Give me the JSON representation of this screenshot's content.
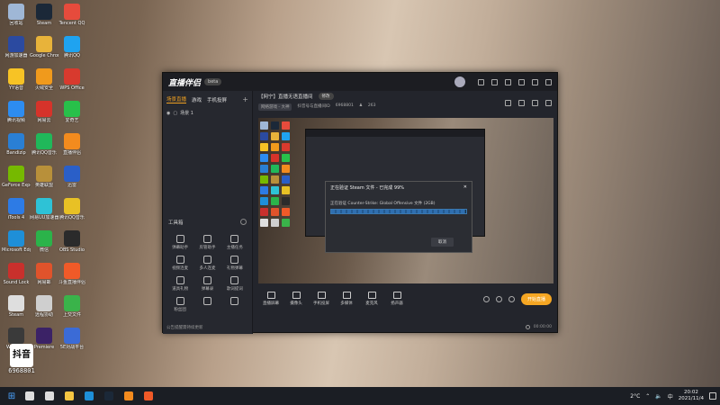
{
  "desktop": {
    "icons": [
      {
        "label": "回收站",
        "color": "#9fb7d6"
      },
      {
        "label": "Steam",
        "color": "#1b2838"
      },
      {
        "label": "Tencent QQ",
        "color": "#e64b3c"
      },
      {
        "label": "网游加速器",
        "color": "#2b4aa0"
      },
      {
        "label": "Google Chrome",
        "color": "#e8b33a"
      },
      {
        "label": "腾讯QQ",
        "color": "#1fa3f0"
      },
      {
        "label": "YY语音",
        "color": "#f7c325"
      },
      {
        "label": "火绒安全",
        "color": "#f09a1c"
      },
      {
        "label": "WPS Office",
        "color": "#d83a2e"
      },
      {
        "label": "腾讯视频",
        "color": "#2d8cf0"
      },
      {
        "label": "网易云",
        "color": "#d6332a"
      },
      {
        "label": "爱奇艺",
        "color": "#28c04a"
      },
      {
        "label": "Bandizip",
        "color": "#2a7fd4"
      },
      {
        "label": "腾讯QQ音乐",
        "color": "#20b85a"
      },
      {
        "label": "直播伴侣",
        "color": "#f38b1e"
      },
      {
        "label": "GeForce Experience",
        "color": "#76b900"
      },
      {
        "label": "英雄联盟",
        "color": "#b8903a"
      },
      {
        "label": "迅雷",
        "color": "#2a5fc8"
      },
      {
        "label": "iTools 4",
        "color": "#2d7be5"
      },
      {
        "label": "网易UU加速器",
        "color": "#2ec2d6"
      },
      {
        "label": "腾讯QQ音乐",
        "color": "#e8c125"
      },
      {
        "label": "Microsoft Edge",
        "color": "#1e8fd8"
      },
      {
        "label": "微信",
        "color": "#2bb34a"
      },
      {
        "label": "OBS Studio",
        "color": "#2b2b2b"
      },
      {
        "label": "Sound Lock",
        "color": "#c9302c"
      },
      {
        "label": "网易邮",
        "color": "#e0532b"
      },
      {
        "label": "斗鱼直播伴侣",
        "color": "#f05a28"
      },
      {
        "label": "Steam",
        "color": "#dedede"
      },
      {
        "label": "远程协助",
        "color": "#cfcfcf"
      },
      {
        "label": "上交文件",
        "color": "#3ab34a"
      },
      {
        "label": "Wegame",
        "color": "#3a3a3a"
      },
      {
        "label": "Premiere",
        "color": "#3b2266"
      },
      {
        "label": "5E对战平台",
        "color": "#3b6bd6"
      }
    ],
    "watermark": {
      "logo": "抖音",
      "id": "6968801"
    }
  },
  "app": {
    "brand": "直播伴侣",
    "version": "beta",
    "left_tabs": [
      "场景直播",
      "游戏",
      "手机投屏"
    ],
    "scene_name": "场景 1",
    "toolbox_title": "工具箱",
    "tools": [
      "弹幕助手",
      "房管助手",
      "主播任务",
      "视频连麦",
      "多人连麦",
      "礼物弹幕",
      "道具礼物",
      "弹幕录",
      "歌词提词",
      "粉丝团",
      "",
      ""
    ],
    "left_footer": "公告提醒需持续更新",
    "room": {
      "title": "【网宁】直播无语直播间",
      "pill": "修改",
      "category": "网络游戏 - 大神",
      "id_text": "抖音号与直播间ID",
      "id": "6968801",
      "viewers": "263"
    },
    "dialog": {
      "title": "正在验证 Steam 文件 - 已完成 99%",
      "message": "正在验证 Counter-Strike: Global Offensive 文件 (2GB)",
      "progress": 0.99,
      "cancel": "取消"
    },
    "bottom_tools": [
      "直播屏幕",
      "摄像头",
      "手机投屏",
      "多媒体",
      "麦克风",
      "扬声器"
    ],
    "start_button": "开始直播",
    "status_time": "00:00:00"
  },
  "taskbar": {
    "items": [
      {
        "name": "search",
        "color": "#ddd"
      },
      {
        "name": "task-view",
        "color": "#ddd"
      },
      {
        "name": "explorer",
        "color": "#f4c542"
      },
      {
        "name": "edge",
        "color": "#1e8fd8"
      },
      {
        "name": "steam",
        "color": "#1b2838"
      },
      {
        "name": "live-companion",
        "color": "#f38b1e"
      },
      {
        "name": "orange-app",
        "color": "#f05a28"
      }
    ],
    "weather": "2°C",
    "ime": "中",
    "time": "20:02",
    "date": "2021/11/4"
  }
}
